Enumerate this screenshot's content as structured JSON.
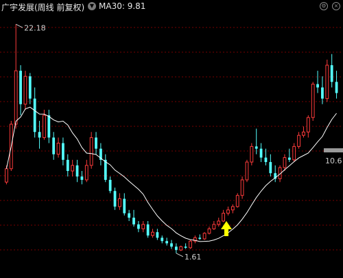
{
  "header": {
    "title": "广宇发展(周线 前复权)",
    "ma_label": "MA30: 9.81",
    "settings_icon": "gear-icon",
    "close_icon": "close-icon",
    "dropdown_icon": "chevron-down-icon"
  },
  "chart_data": {
    "type": "candlestick",
    "title": "广宇发展(周线 前复权)",
    "series": [
      {
        "name": "MA30",
        "last_value": 9.81
      }
    ],
    "annotations": {
      "high_label": "22.18",
      "low_label": "1.61",
      "current_price_label": "10.6"
    },
    "colors": {
      "up": "#ff3b3b",
      "down": "#54ffff",
      "ma": "#ffffff",
      "arrow": "#ffff00",
      "grid": "#7a0000"
    },
    "ylim": [
      0,
      23
    ],
    "candles": [
      [
        8.0,
        9.5,
        7.8,
        9.2
      ],
      [
        9.2,
        13.5,
        9.0,
        13.2
      ],
      [
        13.2,
        22.18,
        12.8,
        18.0
      ],
      [
        18.0,
        18.5,
        14.0,
        15.0
      ],
      [
        15.0,
        18.0,
        14.5,
        17.5
      ],
      [
        17.5,
        17.8,
        15.0,
        15.5
      ],
      [
        15.5,
        16.5,
        12.0,
        12.5
      ],
      [
        12.5,
        13.5,
        11.0,
        12.0
      ],
      [
        12.0,
        14.5,
        11.8,
        14.0
      ],
      [
        14.0,
        14.5,
        11.5,
        12.0
      ],
      [
        12.0,
        12.5,
        10.0,
        10.5
      ],
      [
        10.5,
        12.0,
        10.2,
        11.5
      ],
      [
        11.5,
        12.0,
        9.5,
        10.0
      ],
      [
        10.0,
        10.5,
        8.5,
        9.0
      ],
      [
        9.0,
        10.0,
        8.5,
        9.5
      ],
      [
        9.5,
        10.0,
        8.0,
        8.5
      ],
      [
        8.5,
        9.0,
        7.8,
        8.2
      ],
      [
        8.2,
        10.0,
        8.0,
        9.5
      ],
      [
        9.5,
        12.5,
        9.2,
        12.0
      ],
      [
        12.0,
        12.5,
        10.5,
        11.0
      ],
      [
        11.0,
        11.5,
        9.5,
        10.0
      ],
      [
        10.0,
        10.5,
        8.0,
        8.2
      ],
      [
        8.2,
        8.5,
        7.0,
        7.2
      ],
      [
        7.2,
        7.5,
        5.5,
        5.8
      ],
      [
        5.8,
        7.0,
        5.5,
        6.5
      ],
      [
        6.5,
        7.0,
        5.0,
        5.2
      ],
      [
        5.2,
        5.5,
        4.5,
        4.8
      ],
      [
        4.8,
        5.5,
        4.0,
        4.2
      ],
      [
        4.2,
        4.5,
        3.5,
        3.8
      ],
      [
        3.8,
        4.5,
        3.5,
        4.2
      ],
      [
        4.2,
        4.5,
        3.0,
        3.2
      ],
      [
        3.2,
        3.8,
        3.0,
        3.5
      ],
      [
        3.5,
        3.8,
        2.8,
        3.0
      ],
      [
        3.0,
        3.2,
        2.5,
        2.7
      ],
      [
        2.7,
        3.0,
        2.3,
        2.5
      ],
      [
        2.5,
        2.8,
        2.0,
        2.2
      ],
      [
        2.2,
        2.5,
        1.61,
        1.9
      ],
      [
        1.9,
        2.3,
        1.8,
        2.2
      ],
      [
        2.2,
        2.5,
        2.0,
        2.1
      ],
      [
        2.1,
        2.8,
        2.0,
        2.7
      ],
      [
        2.7,
        3.2,
        2.5,
        3.0
      ],
      [
        3.0,
        3.3,
        2.8,
        2.9
      ],
      [
        2.9,
        3.5,
        2.8,
        3.4
      ],
      [
        3.4,
        4.0,
        3.3,
        3.8
      ],
      [
        3.8,
        4.5,
        3.7,
        4.2
      ],
      [
        4.2,
        4.8,
        4.0,
        4.5
      ],
      [
        4.5,
        5.5,
        4.4,
        5.2
      ],
      [
        5.2,
        5.8,
        5.0,
        5.5
      ],
      [
        5.5,
        6.0,
        5.2,
        5.8
      ],
      [
        5.8,
        7.0,
        5.7,
        6.8
      ],
      [
        6.8,
        8.5,
        6.5,
        8.2
      ],
      [
        8.2,
        10.0,
        8.0,
        9.8
      ],
      [
        9.8,
        11.5,
        9.5,
        11.2
      ],
      [
        11.2,
        12.8,
        10.5,
        11.0
      ],
      [
        11.0,
        11.5,
        9.8,
        10.2
      ],
      [
        10.2,
        11.0,
        9.5,
        9.8
      ],
      [
        9.8,
        10.5,
        8.5,
        8.8
      ],
      [
        8.8,
        9.5,
        8.0,
        8.3
      ],
      [
        8.3,
        9.5,
        8.0,
        9.3
      ],
      [
        9.3,
        10.5,
        9.0,
        10.2
      ],
      [
        10.2,
        11.0,
        9.8,
        10.0
      ],
      [
        10.0,
        11.5,
        9.8,
        11.2
      ],
      [
        11.2,
        12.5,
        11.0,
        12.2
      ],
      [
        12.2,
        13.0,
        12.0,
        12.5
      ],
      [
        12.5,
        14.0,
        12.0,
        13.8
      ],
      [
        13.8,
        17.0,
        13.5,
        16.8
      ],
      [
        16.8,
        18.0,
        16.0,
        16.5
      ],
      [
        16.5,
        17.5,
        15.0,
        15.5
      ],
      [
        15.5,
        19.0,
        15.2,
        18.5
      ],
      [
        18.5,
        19.5,
        16.5,
        17.0
      ],
      [
        17.0,
        18.0,
        15.5,
        16.0
      ]
    ]
  }
}
